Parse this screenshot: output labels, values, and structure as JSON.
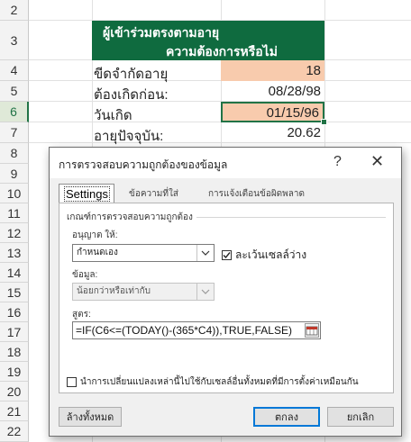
{
  "sheet": {
    "rows": [
      "2",
      "3",
      "4",
      "5",
      "6",
      "7",
      "8",
      "9",
      "10",
      "11",
      "12",
      "13",
      "14",
      "15",
      "16",
      "17",
      "18",
      "19",
      "20",
      "21",
      "22"
    ],
    "active_row": "6",
    "header_line1": "ผู้เข้าร่วมตรงตามอายุ",
    "header_line2": "ความต้องการหรือไม่",
    "cells": [
      {
        "label": "ขีดจำกัดอายุ",
        "value": "18"
      },
      {
        "label": "ต้องเกิดก่อน:",
        "value": "08/28/98"
      },
      {
        "label": "วันเกิด",
        "value": "01/15/96"
      },
      {
        "label": "อายุปัจจุบัน:",
        "value": "20.62"
      }
    ],
    "colors": {
      "header_green": "#0f6b3f",
      "input_orange": "#f8cbad",
      "active_green": "#217346"
    }
  },
  "dialog": {
    "title": "การตรวจสอบความถูกต้องของข้อมูล",
    "help_glyph": "?",
    "close_glyph": "✕",
    "tabs": [
      "Settings",
      "ข้อความที่ใส่",
      "การแจ้งเตือนข้อผิดพลาด"
    ],
    "criteria_group": "เกณฑ์การตรวจสอบความถูกต้อง",
    "allow_label": "อนุญาต ให้:",
    "allow_value": "กำหนดเอง",
    "ignore_blank_label": "ละเว้นเซลล์ว่าง",
    "ignore_blank_checked": true,
    "data_label": "ข้อมูล:",
    "data_value": "น้อยกว่าหรือเท่ากับ",
    "formula_label": "สูตร:",
    "formula_value": "=IF(C6<=(TODAY()-(365*C4)),TRUE,FALSE)",
    "apply_all_label": "นำการเปลี่ยนแปลงเหล่านี้ไปใช้กับเซลล์อื่นทั้งหมดที่มีการตั้งค่าเหมือนกัน",
    "apply_all_checked": false,
    "clear_all_label": "ล้างทั้งหมด",
    "ok_label": "ตกลง",
    "cancel_label": "ยกเลิก"
  }
}
